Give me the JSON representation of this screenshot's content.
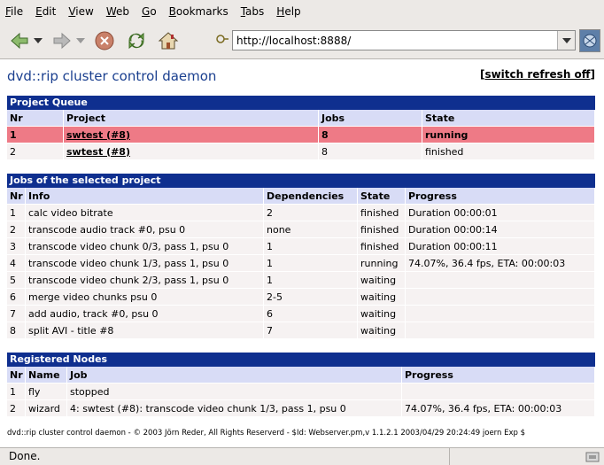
{
  "menu": [
    "File",
    "Edit",
    "View",
    "Web",
    "Go",
    "Bookmarks",
    "Tabs",
    "Help"
  ],
  "menu_underline": [
    "F",
    "E",
    "V",
    "W",
    "G",
    "B",
    "T",
    "H"
  ],
  "menu_rest": [
    "ile",
    "dit",
    "iew",
    "eb",
    "o",
    "ookmarks",
    "abs",
    "elp"
  ],
  "toolbar": {
    "url": "http://localhost:8888/"
  },
  "page": {
    "title": "dvd::rip cluster control daemon",
    "refresh_open": "[",
    "refresh_link": "switch refresh off",
    "refresh_close": "]"
  },
  "project_queue": {
    "heading": "Project Queue",
    "headers": [
      "Nr",
      "Project",
      "Jobs",
      "State"
    ],
    "rows": [
      {
        "nr": "1",
        "project": "swtest (#8)",
        "jobs": "8",
        "state": "running"
      },
      {
        "nr": "2",
        "project": "swtest (#8)",
        "jobs": "8",
        "state": "finished"
      }
    ]
  },
  "jobs": {
    "heading": "Jobs of the selected project",
    "headers": [
      "Nr",
      "Info",
      "Dependencies",
      "State",
      "Progress"
    ],
    "rows": [
      {
        "nr": "1",
        "info": "calc video bitrate",
        "deps": "2",
        "state": "finished",
        "progress": "Duration 00:00:01"
      },
      {
        "nr": "2",
        "info": "transcode audio track #0, psu 0",
        "deps": "none",
        "state": "finished",
        "progress": "Duration 00:00:14"
      },
      {
        "nr": "3",
        "info": "transcode video chunk 0/3, pass 1, psu 0",
        "deps": "1",
        "state": "finished",
        "progress": "Duration 00:00:11"
      },
      {
        "nr": "4",
        "info": "transcode video chunk 1/3, pass 1, psu 0",
        "deps": "1",
        "state": "running",
        "progress": "74.07%, 36.4 fps, ETA: 00:00:03"
      },
      {
        "nr": "5",
        "info": "transcode video chunk 2/3, pass 1, psu 0",
        "deps": "1",
        "state": "waiting",
        "progress": ""
      },
      {
        "nr": "6",
        "info": "merge video chunks psu 0",
        "deps": "2-5",
        "state": "waiting",
        "progress": ""
      },
      {
        "nr": "7",
        "info": "add audio, track #0, psu 0",
        "deps": "6",
        "state": "waiting",
        "progress": ""
      },
      {
        "nr": "8",
        "info": "split AVI - title #8",
        "deps": "7",
        "state": "waiting",
        "progress": ""
      }
    ]
  },
  "nodes": {
    "heading": "Registered Nodes",
    "headers": [
      "Nr",
      "Name",
      "Job",
      "Progress"
    ],
    "rows": [
      {
        "nr": "1",
        "name": "fly",
        "job": "stopped",
        "progress": ""
      },
      {
        "nr": "2",
        "name": "wizard",
        "job": "4: swtest (#8): transcode video chunk 1/3, pass 1, psu 0",
        "progress": "74.07%, 36.4 fps, ETA: 00:00:03"
      }
    ]
  },
  "footer": "dvd::rip cluster control daemon - © 2003 Jörn Reder, All Rights Reserverd - $Id: Webserver.pm,v 1.1.2.1 2003/04/29 20:24:49 joern Exp $",
  "status": "Done.",
  "colors": {
    "header_bar": "#0f2f8f",
    "column_header": "#d8dcf6",
    "highlight_row": "#ee7a86",
    "title": "#1a3f8f"
  }
}
